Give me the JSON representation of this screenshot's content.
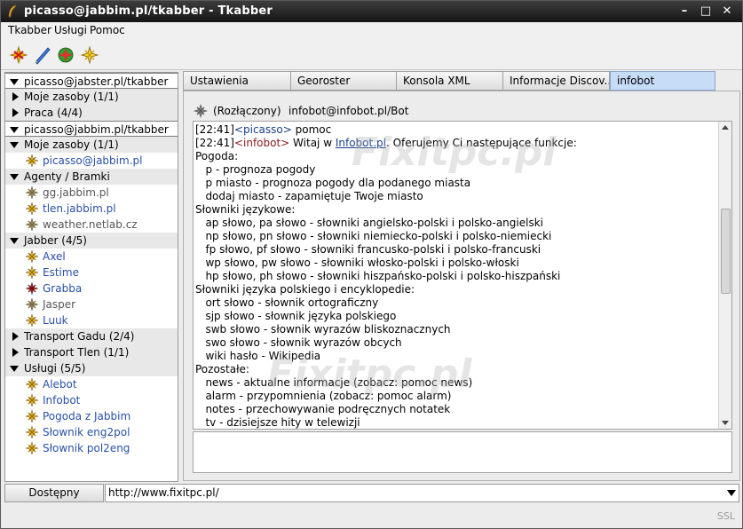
{
  "window": {
    "title": "picasso@jabbim.pl/tkabber - Tkabber",
    "minimize": "–",
    "maximize": "□",
    "close": "✕"
  },
  "menu": [
    "Tkabber",
    "Usługi",
    "Pomoc"
  ],
  "toolbar": {
    "buttons": [
      "connect-icon",
      "send-message-icon",
      "add-contact-icon",
      "status-icon"
    ]
  },
  "roster": {
    "rows": [
      {
        "type": "account",
        "label": "picasso@jabster.pl/tkabber",
        "expanded": true
      },
      {
        "type": "group",
        "label": "Moje zasoby (1/1)",
        "expanded": false
      },
      {
        "type": "group",
        "label": "Praca (4/4)",
        "expanded": false
      },
      {
        "type": "account",
        "label": "picasso@jabbim.pl/tkabber",
        "expanded": true
      },
      {
        "type": "group",
        "label": "Moje zasoby (1/1)",
        "expanded": true
      },
      {
        "type": "contact",
        "label": "picasso@jabbim.pl",
        "status": "online"
      },
      {
        "type": "group",
        "label": "Agenty / Bramki",
        "expanded": true
      },
      {
        "type": "contact",
        "label": "gg.jabbim.pl",
        "status": "offline"
      },
      {
        "type": "contact",
        "label": "tlen.jabbim.pl",
        "status": "online"
      },
      {
        "type": "contact",
        "label": "weather.netlab.cz",
        "status": "offline"
      },
      {
        "type": "group",
        "label": "Jabber (4/5)",
        "expanded": true
      },
      {
        "type": "contact",
        "label": "Axel",
        "status": "online"
      },
      {
        "type": "contact",
        "label": "Estime",
        "status": "online"
      },
      {
        "type": "contact",
        "label": "Grabba",
        "status": "dnd"
      },
      {
        "type": "contact",
        "label": "Jasper",
        "status": "offline"
      },
      {
        "type": "contact",
        "label": "Luuk",
        "status": "online"
      },
      {
        "type": "group",
        "label": "Transport Gadu (2/4)",
        "expanded": false
      },
      {
        "type": "group",
        "label": "Transport Tlen (1/1)",
        "expanded": false
      },
      {
        "type": "group",
        "label": "Usługi (5/5)",
        "expanded": true
      },
      {
        "type": "contact",
        "label": "Alebot",
        "status": "online"
      },
      {
        "type": "contact",
        "label": "Infobot",
        "status": "online"
      },
      {
        "type": "contact",
        "label": "Pogoda z Jabbim",
        "status": "online"
      },
      {
        "type": "contact",
        "label": "Słownik eng2pol",
        "status": "online"
      },
      {
        "type": "contact",
        "label": "Słownik pol2eng",
        "status": "online"
      }
    ]
  },
  "status": {
    "button": "Dostępny",
    "url": "http://www.fixitpc.pl/",
    "ssl": "SSL"
  },
  "tabs": [
    {
      "label": "Ustawienia",
      "active": false
    },
    {
      "label": "Georoster",
      "active": false
    },
    {
      "label": "Konsola XML",
      "active": false
    },
    {
      "label": "Informacje Discov...",
      "active": false
    },
    {
      "label": "infobot",
      "active": true
    }
  ],
  "chat": {
    "header_status": "(Rozłączony)",
    "header_jid": "infobot@infobot.pl/Bot",
    "msg1": {
      "time": "[22:41]",
      "nick": "<picasso>",
      "text": " pomoc"
    },
    "msg2": {
      "time": "[22:41]",
      "nick": "<infobot>",
      "pre": " Witaj w ",
      "link": "Infobot.pl",
      "post": ". Oferujemy Ci następujące funkcje:"
    },
    "lines": [
      "Pogoda:",
      "   p - prognoza pogody",
      "   p miasto - prognoza pogody dla podanego miasta",
      "   dodaj miasto - zapamiętuje Twoje miasto",
      "Słowniki językowe:",
      "   ap słowo, pa słowo - słowniki angielsko-polski i polsko-angielski",
      "   np słowo, pn słowo - słowniki niemiecko-polski i polsko-niemiecki",
      "   fp słowo, pf słowo - słowniki francusko-polski i polsko-francuski",
      "   wp słowo, pw słowo - słowniki włosko-polski i polsko-włoski",
      "   hp słowo, ph słowo - słowniki hiszpańsko-polski i polsko-hiszpański",
      "Słowniki języka polskiego i encyklopedie:",
      "   ort słowo - słownik ortograficzny",
      "   sjp słowo - słownik języka polskiego",
      "   swb słowo - słownik wyrazów bliskoznacznych",
      "   swo słowo - słownik wyrazów obcych",
      "   wiki hasło - Wikipedia",
      "Pozostałe:",
      "   news - aktualne informacje (zobacz: pomoc news)",
      "   alarm - przypomnienia (zobacz: pomoc alarm)",
      "   notes - przechowywanie podręcznych notatek",
      "   tv - dzisiejsze hity w telewizji"
    ]
  },
  "watermark": "Fixitpc.pl",
  "colors": {
    "online": "#f5b800",
    "offline": "#8a8a8a",
    "dnd": "#b01818",
    "link": "#1a3f8b",
    "active_tab": "#c6dcf7"
  }
}
